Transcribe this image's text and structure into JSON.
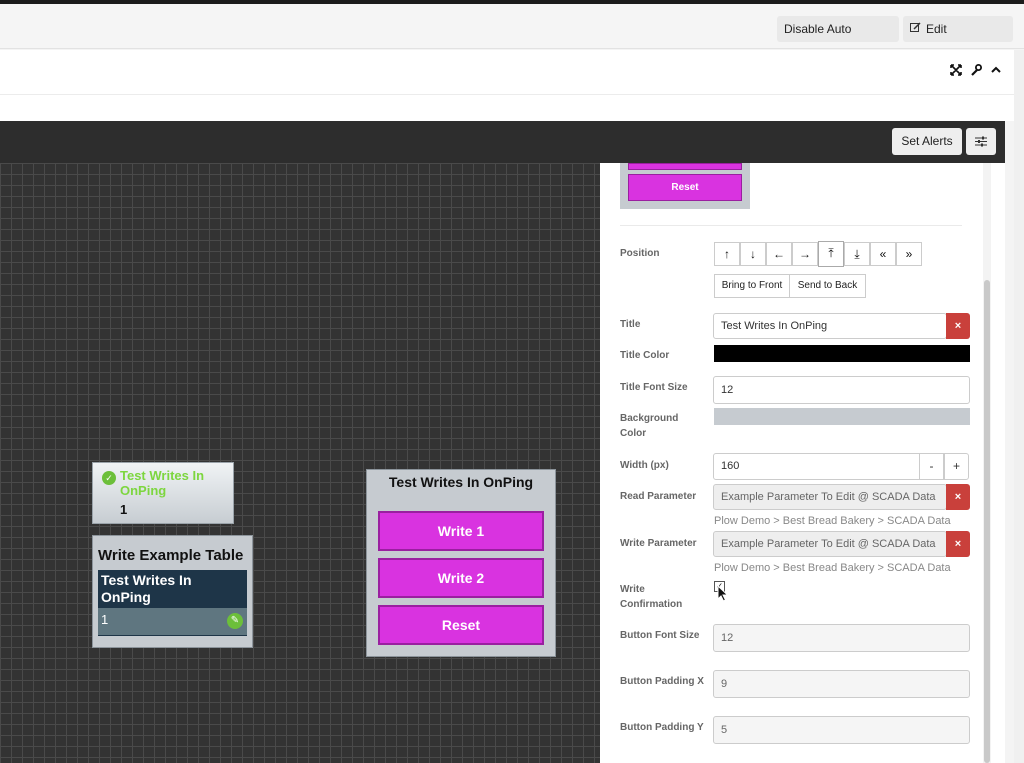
{
  "topbar": {
    "disable_refresh": "Disable Auto Refresh",
    "edit_dashboard": "Edit Dashboard"
  },
  "toolbar": {
    "set_alerts": "Set Alerts"
  },
  "icons": {
    "expand": "expand-icon",
    "wrench": "wrench-icon",
    "collapse": "chevron-up-icon",
    "sliders": "sliders-icon",
    "edit": "edit-icon",
    "check": "check-icon"
  },
  "colors": {
    "accent_magenta": "#d933e0",
    "green": "#7dd63f",
    "danger": "#c9403b",
    "dark_table": "#1e3548"
  },
  "canvas": {
    "widget_value": {
      "title": "Test Writes In OnPing",
      "value": "1"
    },
    "widget_table": {
      "title": "Write Example Table",
      "header": "Test Writes In OnPing",
      "row_value": "1"
    },
    "widget_buttons": {
      "title": "Test Writes In OnPing",
      "buttons": [
        "Write 1",
        "Write 2",
        "Reset"
      ]
    }
  },
  "panel": {
    "preview_reset": "Reset",
    "position_label": "Position",
    "position_buttons": [
      "↑",
      "↓",
      "←",
      "→",
      "⤒",
      "⤓",
      "«",
      "»"
    ],
    "bring_to_front": "Bring to Front",
    "send_to_back": "Send to Back",
    "title_label": "Title",
    "title_value": "Test Writes In OnPing",
    "title_color_label": "Title Color",
    "title_color": "#000000",
    "title_font_size_label": "Title Font Size",
    "title_font_size": "12",
    "background_color_label": "Background Color",
    "background_color": "#c6cbd0",
    "width_label": "Width (px)",
    "width_value": "160",
    "minus": "-",
    "plus": "+",
    "read_param_label": "Read Parameter",
    "read_param_value": "Example Parameter To Edit @ SCADA Data",
    "read_param_path": "Plow Demo > Best Bread Bakery > SCADA Data",
    "write_param_label": "Write Parameter",
    "write_param_value": "Example Parameter To Edit @ SCADA Data",
    "write_param_path": "Plow Demo > Best Bread Bakery > SCADA Data",
    "write_confirm_label": "Write Confirmation",
    "write_confirm_checked": true,
    "button_font_size_label": "Button Font Size",
    "button_font_size": "12",
    "button_padding_x_label": "Button Padding X",
    "button_padding_x": "9",
    "button_padding_y_label": "Button Padding Y",
    "button_padding_y": "5",
    "clear": "×"
  }
}
